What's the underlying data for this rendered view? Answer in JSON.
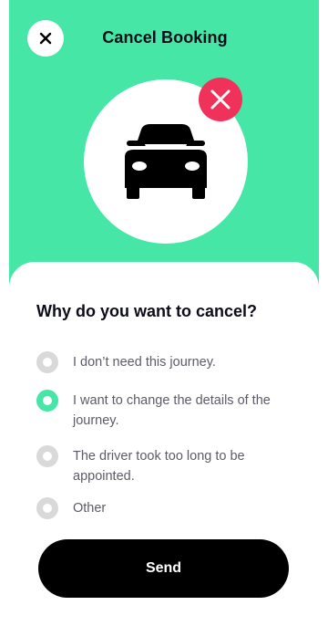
{
  "header": {
    "title": "Cancel Booking",
    "close_icon": "close-icon"
  },
  "hero": {
    "icon": "car-icon",
    "badge_icon": "cancel-x-icon"
  },
  "form": {
    "question": "Why do you want to cancel?",
    "options": [
      {
        "label": "I don’t need this journey.",
        "selected": false
      },
      {
        "label": "I want to change the details of the journey.",
        "selected": true
      },
      {
        "label": "The driver took too long to be appointed.",
        "selected": false
      },
      {
        "label": "Other",
        "selected": false
      }
    ],
    "send_label": "Send"
  },
  "colors": {
    "accent": "#45e6a6",
    "danger": "#f0325a",
    "primary_button": "#000000",
    "radio_off": "#d9d9d9"
  }
}
